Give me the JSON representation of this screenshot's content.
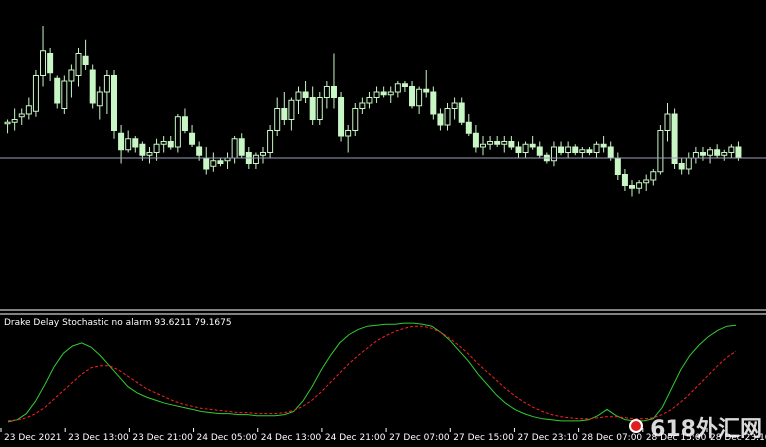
{
  "indicator": {
    "label": "Drake Delay Stochastic no alarm 93.6211 79.1675"
  },
  "colors": {
    "background": "#000000",
    "candle": "#c8f7c5",
    "stoch_main": "#32cd32",
    "stoch_signal": "#ff2020",
    "hline": "#9aa0b8",
    "separator": "#ffffff"
  },
  "chart_data": [
    {
      "type": "candlestick",
      "price_line_level": 0.48,
      "candles": [
        [
          0.61,
          0.62,
          0.57,
          0.61
        ],
        [
          0.61,
          0.66,
          0.58,
          0.62
        ],
        [
          0.63,
          0.66,
          0.6,
          0.64
        ],
        [
          0.64,
          0.7,
          0.62,
          0.67
        ],
        [
          0.65,
          0.8,
          0.63,
          0.78
        ],
        [
          0.78,
          0.96,
          0.74,
          0.87
        ],
        [
          0.86,
          0.88,
          0.76,
          0.79
        ],
        [
          0.77,
          0.78,
          0.66,
          0.68
        ],
        [
          0.66,
          0.78,
          0.64,
          0.76
        ],
        [
          0.76,
          0.82,
          0.7,
          0.8
        ],
        [
          0.78,
          0.88,
          0.74,
          0.86
        ],
        [
          0.85,
          0.91,
          0.8,
          0.82
        ],
        [
          0.8,
          0.82,
          0.66,
          0.68
        ],
        [
          0.67,
          0.74,
          0.62,
          0.72
        ],
        [
          0.72,
          0.8,
          0.64,
          0.78
        ],
        [
          0.78,
          0.8,
          0.55,
          0.58
        ],
        [
          0.57,
          0.6,
          0.46,
          0.51
        ],
        [
          0.51,
          0.58,
          0.5,
          0.55
        ],
        [
          0.55,
          0.56,
          0.5,
          0.52
        ],
        [
          0.53,
          0.54,
          0.47,
          0.49
        ],
        [
          0.49,
          0.52,
          0.46,
          0.5
        ],
        [
          0.5,
          0.55,
          0.47,
          0.53
        ],
        [
          0.53,
          0.56,
          0.5,
          0.54
        ],
        [
          0.54,
          0.56,
          0.51,
          0.52
        ],
        [
          0.52,
          0.64,
          0.5,
          0.63
        ],
        [
          0.63,
          0.66,
          0.57,
          0.58
        ],
        [
          0.57,
          0.6,
          0.52,
          0.53
        ],
        [
          0.52,
          0.54,
          0.47,
          0.49
        ],
        [
          0.48,
          0.52,
          0.42,
          0.44
        ],
        [
          0.45,
          0.5,
          0.43,
          0.47
        ],
        [
          0.47,
          0.48,
          0.45,
          0.46
        ],
        [
          0.47,
          0.5,
          0.44,
          0.48
        ],
        [
          0.48,
          0.56,
          0.46,
          0.55
        ],
        [
          0.55,
          0.57,
          0.48,
          0.49
        ],
        [
          0.5,
          0.52,
          0.44,
          0.46
        ],
        [
          0.46,
          0.5,
          0.44,
          0.49
        ],
        [
          0.49,
          0.52,
          0.46,
          0.5
        ],
        [
          0.5,
          0.6,
          0.48,
          0.58
        ],
        [
          0.58,
          0.7,
          0.56,
          0.66
        ],
        [
          0.66,
          0.72,
          0.6,
          0.62
        ],
        [
          0.62,
          0.7,
          0.58,
          0.69
        ],
        [
          0.69,
          0.74,
          0.64,
          0.72
        ],
        [
          0.72,
          0.76,
          0.68,
          0.7
        ],
        [
          0.7,
          0.74,
          0.6,
          0.62
        ],
        [
          0.62,
          0.72,
          0.6,
          0.7
        ],
        [
          0.7,
          0.76,
          0.66,
          0.74
        ],
        [
          0.74,
          0.86,
          0.66,
          0.7
        ],
        [
          0.7,
          0.72,
          0.54,
          0.56
        ],
        [
          0.56,
          0.6,
          0.5,
          0.58
        ],
        [
          0.58,
          0.68,
          0.56,
          0.66
        ],
        [
          0.66,
          0.7,
          0.64,
          0.68
        ],
        [
          0.68,
          0.72,
          0.66,
          0.7
        ],
        [
          0.7,
          0.74,
          0.68,
          0.72
        ],
        [
          0.72,
          0.74,
          0.7,
          0.71
        ],
        [
          0.71,
          0.74,
          0.68,
          0.72
        ],
        [
          0.72,
          0.76,
          0.7,
          0.75
        ],
        [
          0.75,
          0.76,
          0.72,
          0.74
        ],
        [
          0.74,
          0.76,
          0.66,
          0.67
        ],
        [
          0.67,
          0.74,
          0.64,
          0.73
        ],
        [
          0.73,
          0.8,
          0.7,
          0.72
        ],
        [
          0.72,
          0.74,
          0.62,
          0.64
        ],
        [
          0.64,
          0.66,
          0.58,
          0.6
        ],
        [
          0.6,
          0.68,
          0.58,
          0.66
        ],
        [
          0.66,
          0.7,
          0.62,
          0.68
        ],
        [
          0.68,
          0.7,
          0.6,
          0.61
        ],
        [
          0.61,
          0.64,
          0.56,
          0.57
        ],
        [
          0.57,
          0.6,
          0.5,
          0.52
        ],
        [
          0.52,
          0.56,
          0.49,
          0.53
        ],
        [
          0.53,
          0.56,
          0.51,
          0.54
        ],
        [
          0.54,
          0.56,
          0.52,
          0.53
        ],
        [
          0.53,
          0.56,
          0.5,
          0.54
        ],
        [
          0.54,
          0.56,
          0.51,
          0.52
        ],
        [
          0.52,
          0.54,
          0.48,
          0.5
        ],
        [
          0.5,
          0.54,
          0.48,
          0.53
        ],
        [
          0.53,
          0.56,
          0.51,
          0.52
        ],
        [
          0.52,
          0.54,
          0.48,
          0.49
        ],
        [
          0.49,
          0.5,
          0.46,
          0.47
        ],
        [
          0.47,
          0.54,
          0.45,
          0.52
        ],
        [
          0.52,
          0.54,
          0.49,
          0.5
        ],
        [
          0.5,
          0.54,
          0.48,
          0.52
        ],
        [
          0.52,
          0.53,
          0.49,
          0.5
        ],
        [
          0.5,
          0.52,
          0.48,
          0.51
        ],
        [
          0.51,
          0.52,
          0.49,
          0.5
        ],
        [
          0.5,
          0.54,
          0.48,
          0.53
        ],
        [
          0.53,
          0.56,
          0.5,
          0.52
        ],
        [
          0.52,
          0.54,
          0.47,
          0.48
        ],
        [
          0.48,
          0.5,
          0.4,
          0.42
        ],
        [
          0.42,
          0.44,
          0.36,
          0.38
        ],
        [
          0.38,
          0.4,
          0.34,
          0.37
        ],
        [
          0.37,
          0.4,
          0.35,
          0.39
        ],
        [
          0.39,
          0.42,
          0.36,
          0.4
        ],
        [
          0.4,
          0.44,
          0.38,
          0.43
        ],
        [
          0.43,
          0.6,
          0.42,
          0.58
        ],
        [
          0.58,
          0.68,
          0.54,
          0.64
        ],
        [
          0.64,
          0.66,
          0.44,
          0.46
        ],
        [
          0.46,
          0.48,
          0.42,
          0.44
        ],
        [
          0.44,
          0.5,
          0.42,
          0.48
        ],
        [
          0.48,
          0.52,
          0.46,
          0.5
        ],
        [
          0.5,
          0.52,
          0.47,
          0.49
        ],
        [
          0.49,
          0.52,
          0.46,
          0.51
        ],
        [
          0.51,
          0.53,
          0.48,
          0.49
        ],
        [
          0.49,
          0.51,
          0.47,
          0.5
        ],
        [
          0.5,
          0.53,
          0.48,
          0.52
        ],
        [
          0.52,
          0.54,
          0.47,
          0.48
        ]
      ]
    },
    {
      "type": "line",
      "series": [
        {
          "values": [
            2,
            4,
            10,
            22,
            38,
            55,
            68,
            75,
            78,
            74,
            66,
            56,
            46,
            36,
            30,
            26,
            23,
            20,
            18,
            16,
            14,
            12,
            11,
            10,
            10,
            9,
            9,
            8,
            8,
            8,
            9,
            12,
            22,
            36,
            52,
            66,
            78,
            86,
            91,
            94,
            95,
            96,
            96,
            97,
            97,
            96,
            94,
            88,
            80,
            70,
            60,
            48,
            38,
            28,
            20,
            14,
            10,
            7,
            5,
            4,
            3,
            3,
            3,
            4,
            8,
            14,
            8,
            4,
            3,
            3,
            5,
            16,
            34,
            52,
            66,
            76,
            84,
            90,
            94,
            95
          ]
        },
        {
          "values": [
            3,
            4,
            6,
            10,
            16,
            24,
            32,
            40,
            48,
            54,
            56,
            56,
            52,
            46,
            40,
            34,
            30,
            26,
            22,
            19,
            17,
            15,
            14,
            13,
            12,
            11,
            11,
            10,
            10,
            10,
            11,
            13,
            17,
            23,
            31,
            40,
            49,
            58,
            66,
            73,
            80,
            85,
            89,
            92,
            94,
            94,
            92,
            88,
            82,
            75,
            67,
            58,
            50,
            42,
            34,
            27,
            21,
            16,
            12,
            9,
            7,
            6,
            5,
            5,
            6,
            7,
            7,
            6,
            5,
            5,
            6,
            9,
            14,
            21,
            29,
            38,
            47,
            56,
            64,
            70
          ]
        }
      ],
      "ylim": [
        0,
        100
      ]
    }
  ],
  "x_axis": {
    "labels": [
      "23 Dec 2021",
      "23 Dec 13:00",
      "23 Dec 21:00",
      "24 Dec 05:00",
      "24 Dec 13:00",
      "24 Dec 21:00",
      "27 Dec 07:00",
      "27 Dec 15:00",
      "27 Dec 23:10",
      "28 Dec 07:00",
      "28 Dec 15:00",
      "28 Dec 23:10"
    ]
  },
  "watermark": {
    "text": "618外汇网"
  }
}
